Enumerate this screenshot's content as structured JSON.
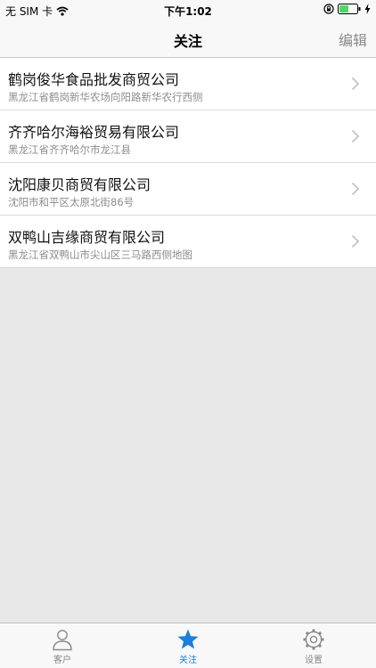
{
  "status_bar": {
    "carrier": "无 SIM 卡",
    "time": "下午1:02"
  },
  "nav": {
    "title": "关注",
    "edit_label": "编辑"
  },
  "companies": [
    {
      "name": "鹤岗俊华食品批发商贸公司",
      "address": "黑龙江省鹤岗新华农场向阳路新华农行西侧"
    },
    {
      "name": "齐齐哈尔海裕贸易有限公司",
      "address": "黑龙江省齐齐哈尔市龙江县"
    },
    {
      "name": "沈阳康贝商贸有限公司",
      "address": "沈阳市和平区太原北街86号"
    },
    {
      "name": "双鸭山吉缘商贸有限公司",
      "address": "黑龙江省双鸭山市尖山区三马路西侧地图"
    }
  ],
  "tabs": [
    {
      "label": "客户",
      "icon": "person-icon",
      "active": false
    },
    {
      "label": "关注",
      "icon": "star-icon",
      "active": true
    },
    {
      "label": "设置",
      "icon": "gear-icon",
      "active": false
    }
  ],
  "colors": {
    "accent": "#1b7fe0",
    "background": "#e8e8e8",
    "battery": "#4cd964"
  }
}
